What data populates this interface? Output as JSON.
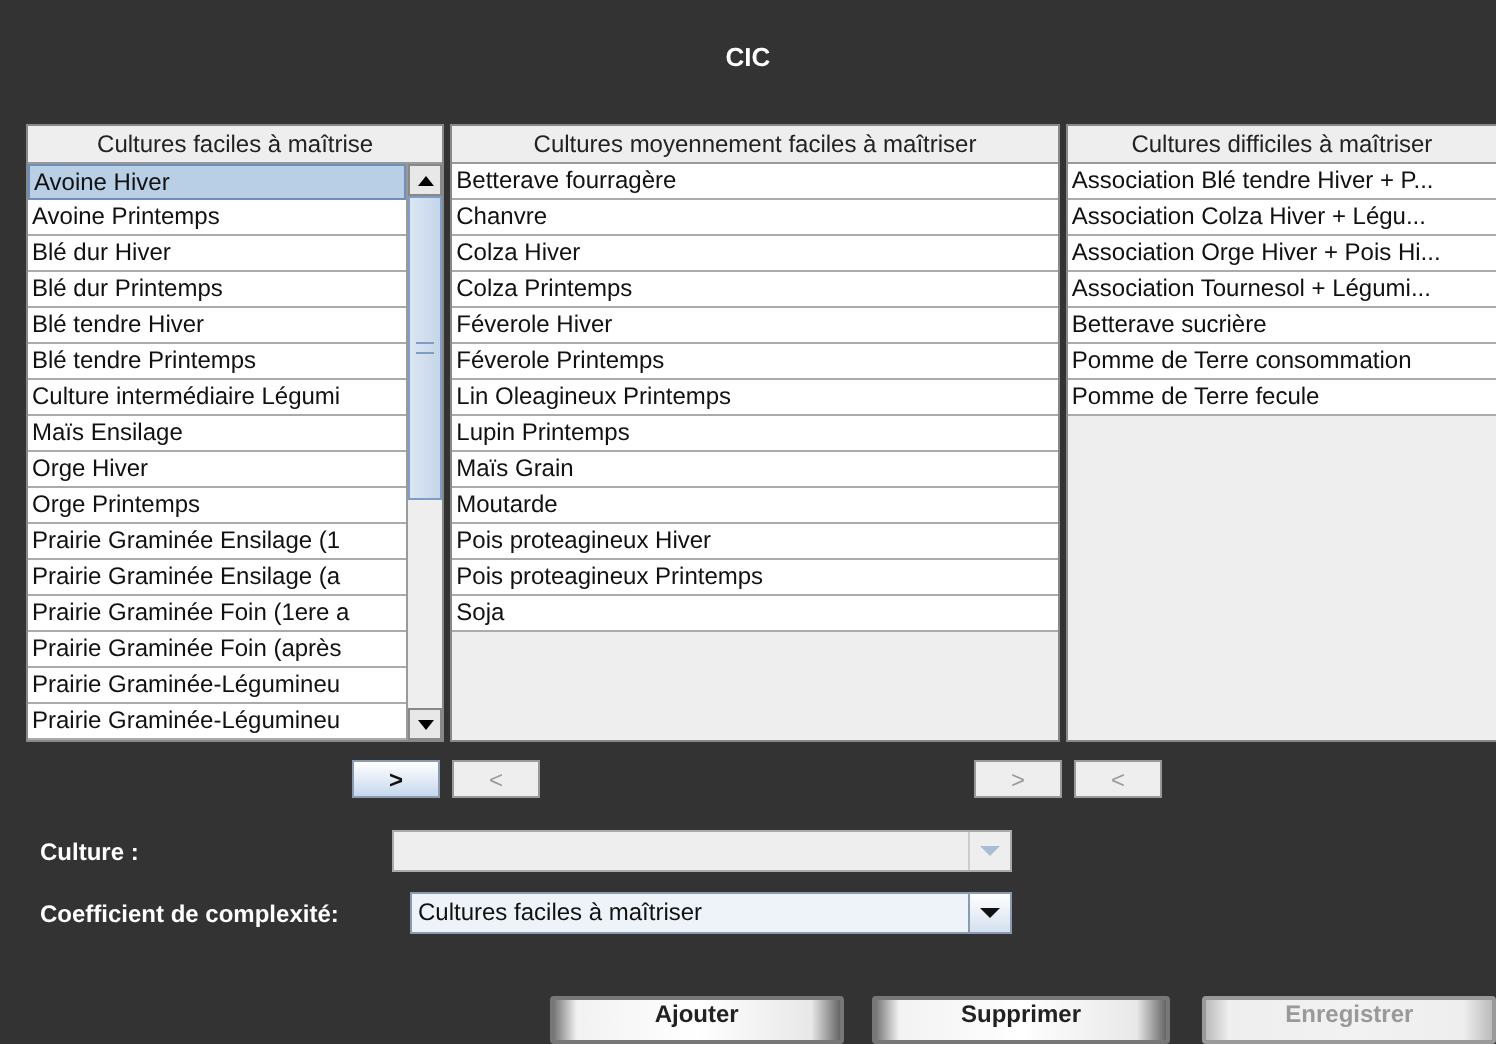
{
  "window": {
    "title": "CIC"
  },
  "lists": [
    {
      "header": "Cultures faciles à maîtrise",
      "scrollbar": true,
      "items": [
        {
          "label": "Avoine Hiver",
          "selected": true
        },
        {
          "label": "Avoine Printemps",
          "selected": false
        },
        {
          "label": "Blé dur Hiver",
          "selected": false
        },
        {
          "label": "Blé dur Printemps",
          "selected": false
        },
        {
          "label": "Blé tendre Hiver",
          "selected": false
        },
        {
          "label": "Blé tendre Printemps",
          "selected": false
        },
        {
          "label": "Culture intermédiaire Légumi",
          "selected": false
        },
        {
          "label": "Maïs Ensilage",
          "selected": false
        },
        {
          "label": "Orge Hiver",
          "selected": false
        },
        {
          "label": "Orge Printemps",
          "selected": false
        },
        {
          "label": "Prairie Graminée Ensilage (1",
          "selected": false
        },
        {
          "label": "Prairie Graminée Ensilage (a",
          "selected": false
        },
        {
          "label": "Prairie Graminée Foin (1ere a",
          "selected": false
        },
        {
          "label": "Prairie Graminée Foin (après",
          "selected": false
        },
        {
          "label": "Prairie Graminée-Légumineu",
          "selected": false
        },
        {
          "label": "Prairie Graminée-Légumineu",
          "selected": false
        }
      ]
    },
    {
      "header": "Cultures moyennement faciles à maîtriser",
      "scrollbar": false,
      "items": [
        {
          "label": "Betterave fourragère",
          "selected": false
        },
        {
          "label": "Chanvre",
          "selected": false
        },
        {
          "label": "Colza Hiver",
          "selected": false
        },
        {
          "label": "Colza Printemps",
          "selected": false
        },
        {
          "label": "Féverole Hiver",
          "selected": false
        },
        {
          "label": "Féverole Printemps",
          "selected": false
        },
        {
          "label": "Lin Oleagineux Printemps",
          "selected": false
        },
        {
          "label": "Lupin Printemps",
          "selected": false
        },
        {
          "label": "Maïs Grain",
          "selected": false
        },
        {
          "label": "Moutarde",
          "selected": false
        },
        {
          "label": "Pois proteagineux Hiver",
          "selected": false
        },
        {
          "label": "Pois proteagineux Printemps",
          "selected": false
        },
        {
          "label": "Soja",
          "selected": false
        }
      ]
    },
    {
      "header": "Cultures difficiles à maîtriser",
      "scrollbar": false,
      "items": [
        {
          "label": "Association Blé tendre Hiver + P...",
          "selected": false
        },
        {
          "label": "Association Colza Hiver + Légu...",
          "selected": false
        },
        {
          "label": "Association Orge Hiver + Pois Hi...",
          "selected": false
        },
        {
          "label": "Association Tournesol + Légumi...",
          "selected": false
        },
        {
          "label": "Betterave sucrière",
          "selected": false
        },
        {
          "label": "Pomme de Terre consommation",
          "selected": false
        },
        {
          "label": "Pomme de Terre fecule",
          "selected": false
        }
      ]
    }
  ],
  "move_buttons": [
    {
      "label": ">",
      "disabled": false
    },
    {
      "label": "<",
      "disabled": true
    },
    {
      "label": ">",
      "disabled": true
    },
    {
      "label": "<",
      "disabled": true
    }
  ],
  "form": [
    {
      "label": "Culture :",
      "disabled": true
    },
    {
      "label": "Coefficient de complexité:",
      "value": "Cultures faciles à maîtriser",
      "disabled": false
    }
  ],
  "actions": [
    {
      "label": "Ajouter",
      "disabled": false
    },
    {
      "label": "Supprimer",
      "disabled": false
    },
    {
      "label": "Enregistrer",
      "disabled": true
    }
  ]
}
